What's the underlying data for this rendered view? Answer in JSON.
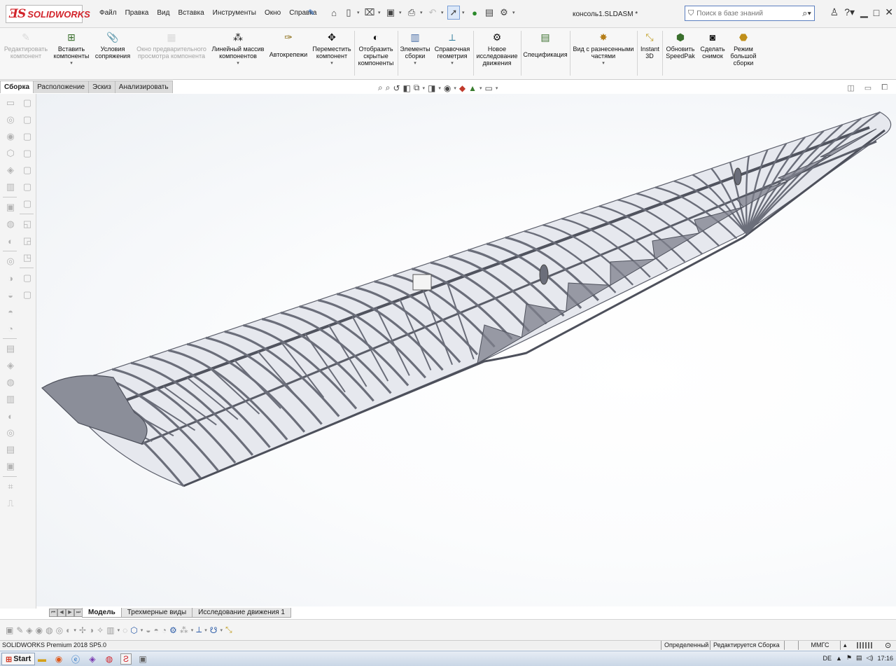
{
  "app": {
    "logo_text": "SOLIDWORKS",
    "document_title": "консоль1.SLDASM *"
  },
  "menu": [
    "Файл",
    "Правка",
    "Вид",
    "Вставка",
    "Инструменты",
    "Окно",
    "Справка"
  ],
  "search": {
    "placeholder": "Поиск в базе знаний"
  },
  "ribbon": {
    "edit_component": "Редактировать компонент",
    "insert_components": "Вставить компоненты",
    "mates": "Условия сопряжения",
    "preview_window": "Окно предварительного просмотра компонента",
    "linear_pattern": "Линейный массив компонентов",
    "smart_fasteners": "Автокрепежи",
    "move_component": "Переместить компонент",
    "show_hidden": "Отобразить скрытые компоненты",
    "assembly_features": "Элементы сборки",
    "reference_geometry": "Справочная геометрия",
    "new_motion_study": "Новое исследование движения",
    "bill_of_materials": "Спецификация",
    "exploded_view": "Вид с разнесенными частями",
    "instant3d": "Instant 3D",
    "update_speedpak": "Обновить SpeedPak",
    "take_snapshot": "Сделать снимок",
    "large_assembly": "Режим большой сборки"
  },
  "tabs": [
    "Сборка",
    "Расположение",
    "Эскиз",
    "Анализировать"
  ],
  "bottom_tabs": [
    "Модель",
    "Трехмерные виды",
    "Исследование движения 1"
  ],
  "status": {
    "product": "SOLIDWORKS Premium 2018 SP5.0",
    "state": "Определенный",
    "editing": "Редактируется Сборка",
    "units": "ММГС"
  },
  "taskbar": {
    "start": "Start",
    "lang": "DE",
    "time": "17:16"
  },
  "colors": {
    "brand_red": "#d2232a",
    "model_gray": "#6b6e7a",
    "accent_blue": "#1d5fb8"
  }
}
